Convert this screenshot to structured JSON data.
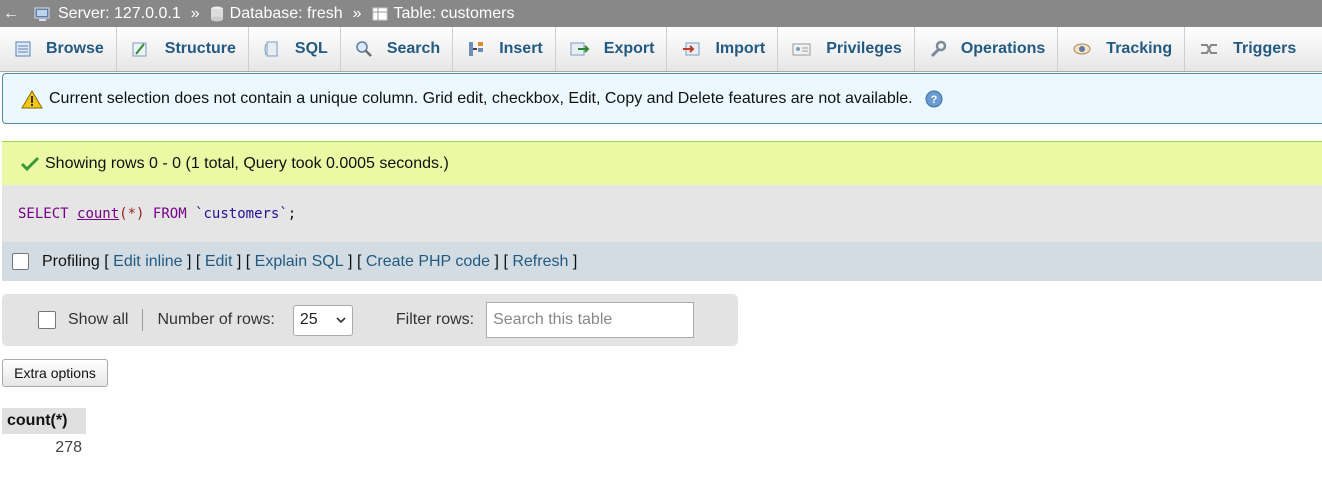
{
  "breadcrumb": {
    "back_glyph": "←",
    "separator": "»",
    "server": "Server: 127.0.0.1",
    "database": "Database: fresh",
    "table": "Table: customers"
  },
  "tabs": [
    {
      "label": "Browse",
      "icon": "browse-icon"
    },
    {
      "label": "Structure",
      "icon": "structure-icon"
    },
    {
      "label": "SQL",
      "icon": "sql-icon"
    },
    {
      "label": "Search",
      "icon": "search-icon"
    },
    {
      "label": "Insert",
      "icon": "insert-icon"
    },
    {
      "label": "Export",
      "icon": "export-icon"
    },
    {
      "label": "Import",
      "icon": "import-icon"
    },
    {
      "label": "Privileges",
      "icon": "privileges-icon"
    },
    {
      "label": "Operations",
      "icon": "operations-icon"
    },
    {
      "label": "Tracking",
      "icon": "tracking-icon"
    },
    {
      "label": "Triggers",
      "icon": "triggers-icon"
    }
  ],
  "notice": {
    "text": "Current selection does not contain a unique column. Grid edit, checkbox, Edit, Copy and Delete features are not available."
  },
  "success": {
    "text": "Showing rows 0 - 0 (1 total, Query took 0.0005 seconds.)"
  },
  "sql": {
    "select": "SELECT",
    "func": "count",
    "arg_open": "(",
    "arg_star": "*",
    "arg_close": ")",
    "from": "FROM",
    "table": "`customers`",
    "end": ";"
  },
  "toolbar": {
    "profiling": "Profiling",
    "open": "[",
    "close": "]",
    "edit_inline": "Edit inline",
    "edit": "Edit",
    "explain": "Explain SQL",
    "php": "Create PHP code",
    "refresh": "Refresh"
  },
  "nav": {
    "show_all": "Show all",
    "num_rows_label": "Number of rows:",
    "num_rows_value": "25",
    "filter_label": "Filter rows:",
    "filter_placeholder": "Search this table"
  },
  "extra_options": "Extra options",
  "result": {
    "columns": [
      "count(*)"
    ],
    "rows": [
      [
        "278"
      ]
    ]
  },
  "colors": {
    "link": "#235a81",
    "success_bg": "#ebf8a4",
    "notice_bg": "#ebf8fd"
  }
}
